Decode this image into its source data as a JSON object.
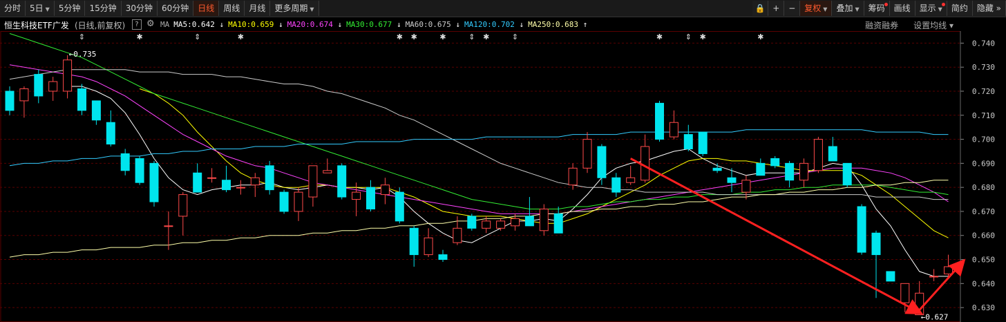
{
  "toolbar": {
    "left": [
      {
        "label": "分时",
        "active": false,
        "dropdown": false
      },
      {
        "label": "5日",
        "active": false,
        "dropdown": true
      },
      {
        "label": "5分钟",
        "active": false,
        "dropdown": false
      },
      {
        "label": "15分钟",
        "active": false,
        "dropdown": false
      },
      {
        "label": "30分钟",
        "active": false,
        "dropdown": false
      },
      {
        "label": "60分钟",
        "active": false,
        "dropdown": false
      },
      {
        "label": "日线",
        "active": true,
        "dropdown": false
      },
      {
        "label": "周线",
        "active": false,
        "dropdown": false
      },
      {
        "label": "月线",
        "active": false,
        "dropdown": false
      },
      {
        "label": "更多周期",
        "active": false,
        "dropdown": true
      }
    ],
    "icons": [
      {
        "name": "lock-icon",
        "glyph": "🔒"
      },
      {
        "name": "zoom-in-icon",
        "glyph": "+"
      },
      {
        "name": "zoom-out-icon",
        "glyph": "−"
      }
    ],
    "right": [
      {
        "label": "复权",
        "active": true,
        "dropdown": true,
        "dot": false
      },
      {
        "label": "叠加",
        "active": false,
        "dropdown": true,
        "dot": false
      },
      {
        "label": "筹码",
        "active": false,
        "dropdown": false,
        "dot": true
      },
      {
        "label": "画线",
        "active": false,
        "dropdown": false,
        "dot": false
      },
      {
        "label": "显示",
        "active": false,
        "dropdown": true,
        "dot": true
      },
      {
        "label": "简约",
        "active": false,
        "dropdown": false,
        "dot": false
      },
      {
        "label": "隐藏",
        "active": false,
        "dropdown": false,
        "dot": false,
        "suffix": "»"
      }
    ]
  },
  "info": {
    "title": "恒生科技ETF广发",
    "subtitle": "(日线,前复权)",
    "help": "?",
    "ma_label": "MA",
    "ma_items": [
      {
        "label": "MA5:0.642",
        "arrow": "↓",
        "color": "#ffffff"
      },
      {
        "label": "MA10:0.659",
        "arrow": "↓",
        "color": "#ffff00"
      },
      {
        "label": "MA20:0.674",
        "arrow": "↓",
        "color": "#ff44ff"
      },
      {
        "label": "MA30:0.677",
        "arrow": "↓",
        "color": "#33ee33"
      },
      {
        "label": "MA60:0.675",
        "arrow": "↓",
        "color": "#cccccc"
      },
      {
        "label": "MA120:0.702",
        "arrow": "↓",
        "color": "#33ccff"
      },
      {
        "label": "MA250:0.683",
        "arrow": "↑",
        "color": "#ffffaa"
      }
    ],
    "right_links": [
      "融资融券",
      "设置均线"
    ]
  },
  "colors": {
    "up": "#ff4a4a",
    "down": "#00e5ee",
    "grid": "#5a0000",
    "axis_text": "#cccccc",
    "arrow": "#ff2020"
  },
  "chart_data": {
    "type": "candlestick",
    "ylim": [
      0.624,
      0.745
    ],
    "yticks": [
      0.63,
      0.64,
      0.65,
      0.66,
      0.67,
      0.68,
      0.69,
      0.7,
      0.71,
      0.72,
      0.73,
      0.74
    ],
    "candles": [
      {
        "o": 0.72,
        "h": 0.722,
        "l": 0.71,
        "c": 0.712
      },
      {
        "o": 0.716,
        "h": 0.722,
        "l": 0.709,
        "c": 0.721
      },
      {
        "o": 0.727,
        "h": 0.729,
        "l": 0.715,
        "c": 0.718
      },
      {
        "o": 0.72,
        "h": 0.726,
        "l": 0.716,
        "c": 0.724
      },
      {
        "o": 0.72,
        "h": 0.735,
        "l": 0.717,
        "c": 0.733
      },
      {
        "o": 0.721,
        "h": 0.723,
        "l": 0.71,
        "c": 0.712
      },
      {
        "o": 0.716,
        "h": 0.716,
        "l": 0.706,
        "c": 0.708
      },
      {
        "o": 0.707,
        "h": 0.712,
        "l": 0.697,
        "c": 0.698
      },
      {
        "o": 0.694,
        "h": 0.696,
        "l": 0.685,
        "c": 0.687
      },
      {
        "o": 0.692,
        "h": 0.693,
        "l": 0.681,
        "c": 0.682
      },
      {
        "o": 0.69,
        "h": 0.691,
        "l": 0.672,
        "c": 0.674
      },
      {
        "o": 0.664,
        "h": 0.67,
        "l": 0.654,
        "c": 0.664
      },
      {
        "o": 0.668,
        "h": 0.678,
        "l": 0.66,
        "c": 0.677
      },
      {
        "o": 0.686,
        "h": 0.69,
        "l": 0.678,
        "c": 0.678
      },
      {
        "o": 0.684,
        "h": 0.688,
        "l": 0.682,
        "c": 0.684
      },
      {
        "o": 0.683,
        "h": 0.689,
        "l": 0.678,
        "c": 0.679
      },
      {
        "o": 0.68,
        "h": 0.683,
        "l": 0.677,
        "c": 0.68
      },
      {
        "o": 0.681,
        "h": 0.686,
        "l": 0.676,
        "c": 0.684
      },
      {
        "o": 0.689,
        "h": 0.691,
        "l": 0.677,
        "c": 0.679
      },
      {
        "o": 0.678,
        "h": 0.679,
        "l": 0.669,
        "c": 0.67
      },
      {
        "o": 0.67,
        "h": 0.68,
        "l": 0.666,
        "c": 0.678
      },
      {
        "o": 0.676,
        "h": 0.689,
        "l": 0.672,
        "c": 0.689
      },
      {
        "o": 0.686,
        "h": 0.692,
        "l": 0.686,
        "c": 0.687
      },
      {
        "o": 0.689,
        "h": 0.69,
        "l": 0.675,
        "c": 0.676
      },
      {
        "o": 0.675,
        "h": 0.682,
        "l": 0.668,
        "c": 0.678
      },
      {
        "o": 0.68,
        "h": 0.683,
        "l": 0.67,
        "c": 0.671
      },
      {
        "o": 0.677,
        "h": 0.684,
        "l": 0.673,
        "c": 0.681
      },
      {
        "o": 0.678,
        "h": 0.68,
        "l": 0.665,
        "c": 0.666
      },
      {
        "o": 0.663,
        "h": 0.664,
        "l": 0.647,
        "c": 0.652
      },
      {
        "o": 0.652,
        "h": 0.663,
        "l": 0.651,
        "c": 0.659
      },
      {
        "o": 0.652,
        "h": 0.654,
        "l": 0.649,
        "c": 0.65
      },
      {
        "o": 0.657,
        "h": 0.668,
        "l": 0.656,
        "c": 0.663
      },
      {
        "o": 0.668,
        "h": 0.669,
        "l": 0.662,
        "c": 0.663
      },
      {
        "o": 0.663,
        "h": 0.668,
        "l": 0.661,
        "c": 0.666
      },
      {
        "o": 0.663,
        "h": 0.667,
        "l": 0.662,
        "c": 0.666
      },
      {
        "o": 0.664,
        "h": 0.669,
        "l": 0.662,
        "c": 0.667
      },
      {
        "o": 0.668,
        "h": 0.676,
        "l": 0.664,
        "c": 0.664
      },
      {
        "o": 0.662,
        "h": 0.673,
        "l": 0.66,
        "c": 0.671
      },
      {
        "o": 0.669,
        "h": 0.672,
        "l": 0.661,
        "c": 0.661
      },
      {
        "o": 0.681,
        "h": 0.69,
        "l": 0.679,
        "c": 0.688
      },
      {
        "o": 0.688,
        "h": 0.703,
        "l": 0.686,
        "c": 0.7
      },
      {
        "o": 0.697,
        "h": 0.698,
        "l": 0.681,
        "c": 0.684
      },
      {
        "o": 0.684,
        "h": 0.686,
        "l": 0.676,
        "c": 0.678
      },
      {
        "o": 0.682,
        "h": 0.689,
        "l": 0.681,
        "c": 0.684
      },
      {
        "o": 0.683,
        "h": 0.702,
        "l": 0.682,
        "c": 0.697
      },
      {
        "o": 0.715,
        "h": 0.716,
        "l": 0.699,
        "c": 0.7
      },
      {
        "o": 0.701,
        "h": 0.712,
        "l": 0.7,
        "c": 0.707
      },
      {
        "o": 0.702,
        "h": 0.706,
        "l": 0.695,
        "c": 0.696
      },
      {
        "o": 0.703,
        "h": 0.703,
        "l": 0.693,
        "c": 0.694
      },
      {
        "o": 0.688,
        "h": 0.69,
        "l": 0.686,
        "c": 0.687
      },
      {
        "o": 0.684,
        "h": 0.688,
        "l": 0.678,
        "c": 0.682
      },
      {
        "o": 0.678,
        "h": 0.685,
        "l": 0.675,
        "c": 0.683
      },
      {
        "o": 0.69,
        "h": 0.692,
        "l": 0.685,
        "c": 0.685
      },
      {
        "o": 0.692,
        "h": 0.693,
        "l": 0.688,
        "c": 0.689
      },
      {
        "o": 0.69,
        "h": 0.691,
        "l": 0.68,
        "c": 0.683
      },
      {
        "o": 0.683,
        "h": 0.692,
        "l": 0.68,
        "c": 0.69
      },
      {
        "o": 0.687,
        "h": 0.701,
        "l": 0.686,
        "c": 0.7
      },
      {
        "o": 0.697,
        "h": 0.701,
        "l": 0.691,
        "c": 0.691
      },
      {
        "o": 0.69,
        "h": 0.69,
        "l": 0.68,
        "c": 0.681
      },
      {
        "o": 0.672,
        "h": 0.673,
        "l": 0.652,
        "c": 0.653
      },
      {
        "o": 0.661,
        "h": 0.662,
        "l": 0.634,
        "c": 0.652
      },
      {
        "o": 0.645,
        "h": 0.645,
        "l": 0.641,
        "c": 0.641
      },
      {
        "o": 0.632,
        "h": 0.64,
        "l": 0.628,
        "c": 0.64
      },
      {
        "o": 0.627,
        "h": 0.641,
        "l": 0.627,
        "c": 0.636
      },
      {
        "o": 0.643,
        "h": 0.646,
        "l": 0.641,
        "c": 0.643
      },
      {
        "o": 0.644,
        "h": 0.652,
        "l": 0.642,
        "c": 0.647
      }
    ],
    "ma_series": [
      {
        "name": "MA5",
        "color": "#ffffff",
        "values": [
          null,
          null,
          null,
          null,
          0.722,
          0.722,
          0.72,
          0.717,
          0.711,
          0.702,
          0.692,
          0.684,
          0.679,
          0.677,
          0.679,
          0.68,
          0.681,
          0.681,
          0.682,
          0.68,
          0.679,
          0.68,
          0.681,
          0.68,
          0.68,
          0.679,
          0.68,
          0.676,
          0.67,
          0.665,
          0.661,
          0.658,
          0.657,
          0.66,
          0.663,
          0.666,
          0.666,
          0.667,
          0.666,
          0.671,
          0.677,
          0.684,
          0.688,
          0.69,
          0.691,
          0.693,
          0.695,
          0.696,
          0.692,
          0.689,
          0.687,
          0.685,
          0.686,
          0.686,
          0.686,
          0.686,
          0.688,
          0.69,
          0.689,
          0.681,
          0.671,
          0.664,
          0.654,
          0.645,
          0.643,
          0.643
        ]
      },
      {
        "name": "MA10",
        "color": "#ffff00",
        "values": [
          null,
          null,
          null,
          null,
          null,
          null,
          null,
          null,
          null,
          0.721,
          0.719,
          0.715,
          0.71,
          0.703,
          0.697,
          0.691,
          0.686,
          0.683,
          0.681,
          0.68,
          0.68,
          0.681,
          0.681,
          0.68,
          0.68,
          0.68,
          0.68,
          0.678,
          0.676,
          0.673,
          0.67,
          0.669,
          0.668,
          0.668,
          0.668,
          0.667,
          0.666,
          0.665,
          0.665,
          0.667,
          0.669,
          0.672,
          0.675,
          0.678,
          0.681,
          0.685,
          0.688,
          0.691,
          0.692,
          0.692,
          0.691,
          0.691,
          0.69,
          0.689,
          0.688,
          0.687,
          0.687,
          0.687,
          0.687,
          0.685,
          0.681,
          0.677,
          0.672,
          0.667,
          0.662,
          0.659
        ]
      },
      {
        "name": "MA20",
        "color": "#ff44ff",
        "values": [
          0.731,
          0.73,
          0.729,
          0.728,
          0.727,
          0.726,
          0.724,
          0.721,
          0.718,
          0.714,
          0.71,
          0.706,
          0.702,
          0.699,
          0.696,
          0.693,
          0.691,
          0.689,
          0.688,
          0.686,
          0.684,
          0.682,
          0.681,
          0.68,
          0.679,
          0.678,
          0.677,
          0.676,
          0.675,
          0.674,
          0.673,
          0.672,
          0.671,
          0.67,
          0.669,
          0.669,
          0.669,
          0.669,
          0.669,
          0.67,
          0.671,
          0.672,
          0.673,
          0.674,
          0.675,
          0.676,
          0.677,
          0.678,
          0.679,
          0.68,
          0.681,
          0.682,
          0.683,
          0.684,
          0.685,
          0.686,
          0.687,
          0.688,
          0.688,
          0.688,
          0.687,
          0.686,
          0.684,
          0.681,
          0.678,
          0.674
        ]
      },
      {
        "name": "MA30",
        "color": "#33ee33",
        "values": [
          0.744,
          0.742,
          0.74,
          0.738,
          0.736,
          0.734,
          0.731,
          0.728,
          0.725,
          0.722,
          0.719,
          0.717,
          0.715,
          0.713,
          0.711,
          0.709,
          0.707,
          0.705,
          0.703,
          0.701,
          0.699,
          0.697,
          0.695,
          0.693,
          0.691,
          0.689,
          0.687,
          0.685,
          0.683,
          0.681,
          0.679,
          0.677,
          0.675,
          0.674,
          0.673,
          0.672,
          0.671,
          0.671,
          0.671,
          0.672,
          0.672,
          0.673,
          0.674,
          0.674,
          0.675,
          0.675,
          0.676,
          0.676,
          0.677,
          0.677,
          0.677,
          0.678,
          0.678,
          0.679,
          0.679,
          0.68,
          0.68,
          0.681,
          0.681,
          0.681,
          0.681,
          0.68,
          0.679,
          0.678,
          0.678,
          0.677
        ]
      },
      {
        "name": "MA60",
        "color": "#cccccc",
        "values": [
          0.725,
          0.726,
          0.727,
          0.728,
          0.729,
          0.729,
          0.729,
          0.729,
          0.729,
          0.728,
          0.728,
          0.728,
          0.727,
          0.727,
          0.727,
          0.726,
          0.726,
          0.725,
          0.724,
          0.723,
          0.723,
          0.722,
          0.72,
          0.719,
          0.717,
          0.715,
          0.713,
          0.71,
          0.708,
          0.705,
          0.702,
          0.699,
          0.696,
          0.693,
          0.69,
          0.688,
          0.686,
          0.684,
          0.682,
          0.681,
          0.68,
          0.68,
          0.679,
          0.679,
          0.678,
          0.678,
          0.678,
          0.678,
          0.678,
          0.677,
          0.677,
          0.677,
          0.677,
          0.677,
          0.677,
          0.677,
          0.677,
          0.677,
          0.677,
          0.677,
          0.676,
          0.676,
          0.676,
          0.676,
          0.675,
          0.675
        ]
      },
      {
        "name": "MA120",
        "color": "#33ccff",
        "values": [
          0.689,
          0.69,
          0.69,
          0.691,
          0.691,
          0.692,
          0.692,
          0.693,
          0.693,
          0.693,
          0.694,
          0.694,
          0.695,
          0.695,
          0.696,
          0.696,
          0.696,
          0.697,
          0.697,
          0.697,
          0.698,
          0.698,
          0.698,
          0.698,
          0.699,
          0.699,
          0.699,
          0.699,
          0.7,
          0.7,
          0.7,
          0.7,
          0.7,
          0.701,
          0.701,
          0.701,
          0.701,
          0.701,
          0.701,
          0.702,
          0.702,
          0.702,
          0.702,
          0.703,
          0.703,
          0.703,
          0.703,
          0.703,
          0.703,
          0.703,
          0.703,
          0.704,
          0.704,
          0.704,
          0.704,
          0.704,
          0.704,
          0.704,
          0.704,
          0.704,
          0.703,
          0.703,
          0.703,
          0.703,
          0.702,
          0.702
        ]
      },
      {
        "name": "MA250",
        "color": "#ffffaa",
        "values": [
          0.651,
          0.652,
          0.652,
          0.653,
          0.653,
          0.654,
          0.654,
          0.655,
          0.655,
          0.655,
          0.656,
          0.656,
          0.657,
          0.657,
          0.658,
          0.658,
          0.659,
          0.659,
          0.66,
          0.66,
          0.66,
          0.661,
          0.661,
          0.662,
          0.662,
          0.663,
          0.663,
          0.664,
          0.664,
          0.665,
          0.665,
          0.666,
          0.666,
          0.667,
          0.667,
          0.668,
          0.668,
          0.669,
          0.669,
          0.67,
          0.67,
          0.671,
          0.671,
          0.672,
          0.672,
          0.673,
          0.673,
          0.674,
          0.674,
          0.675,
          0.676,
          0.676,
          0.677,
          0.677,
          0.678,
          0.678,
          0.679,
          0.679,
          0.68,
          0.68,
          0.681,
          0.681,
          0.682,
          0.682,
          0.683,
          0.683
        ]
      }
    ],
    "annotations": [
      {
        "text": "0.735",
        "candle": 4,
        "value": 0.735,
        "pos": "high"
      },
      {
        "text": "0.627",
        "candle": 63,
        "value": 0.627,
        "pos": "low"
      }
    ],
    "event_markers": [
      {
        "candle": 5,
        "symbol": "⇕"
      },
      {
        "candle": 9,
        "symbol": "✱"
      },
      {
        "candle": 13,
        "symbol": "⇕"
      },
      {
        "candle": 16,
        "symbol": "✱"
      },
      {
        "candle": 27,
        "symbol": "✱"
      },
      {
        "candle": 28,
        "symbol": "✱"
      },
      {
        "candle": 30,
        "symbol": "✱"
      },
      {
        "candle": 32,
        "symbol": "⇕"
      },
      {
        "candle": 33,
        "symbol": "✱"
      },
      {
        "candle": 35,
        "symbol": "⇕"
      },
      {
        "candle": 45,
        "symbol": "✱"
      },
      {
        "candle": 47,
        "symbol": "⇕"
      },
      {
        "candle": 48,
        "symbol": "✱"
      },
      {
        "candle": 52,
        "symbol": "✱"
      }
    ],
    "drawn_arrows": [
      {
        "from": {
          "candle": 43,
          "value": 0.692
        },
        "to": {
          "candle": 63,
          "value": 0.628
        }
      },
      {
        "from": {
          "candle": 63,
          "value": 0.629
        },
        "to": {
          "candle": 66,
          "value": 0.649
        }
      }
    ]
  }
}
